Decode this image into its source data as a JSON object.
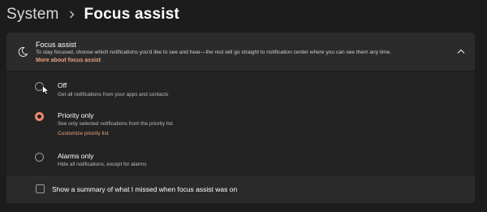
{
  "breadcrumb": {
    "parent": "System",
    "separator": "›",
    "current": "Focus assist"
  },
  "focus_assist": {
    "title": "Focus assist",
    "description": "To stay focused, choose which notifications you'd like to see and hear—the rest will go straight to notification center where you can see them any time.",
    "link": "More about focus assist",
    "expanded": true,
    "header_icon": "moon-icon",
    "collapse_icon": "chevron-up-icon"
  },
  "options": [
    {
      "label": "Off",
      "description": "Get all notifications from your apps and contacts",
      "selected": false
    },
    {
      "label": "Priority only",
      "description": "See only selected notifications from the priority list",
      "link": "Customize priority list",
      "selected": true
    },
    {
      "label": "Alarms only",
      "description": "Hide all notifications, except for alarms",
      "selected": false
    }
  ],
  "summary": {
    "label": "Show a summary of what I missed when focus assist was on",
    "checked": false
  },
  "colors": {
    "accent": "#f08a6e",
    "link": "#e8a47f",
    "background": "#1c1c1c",
    "card": "#272727"
  }
}
